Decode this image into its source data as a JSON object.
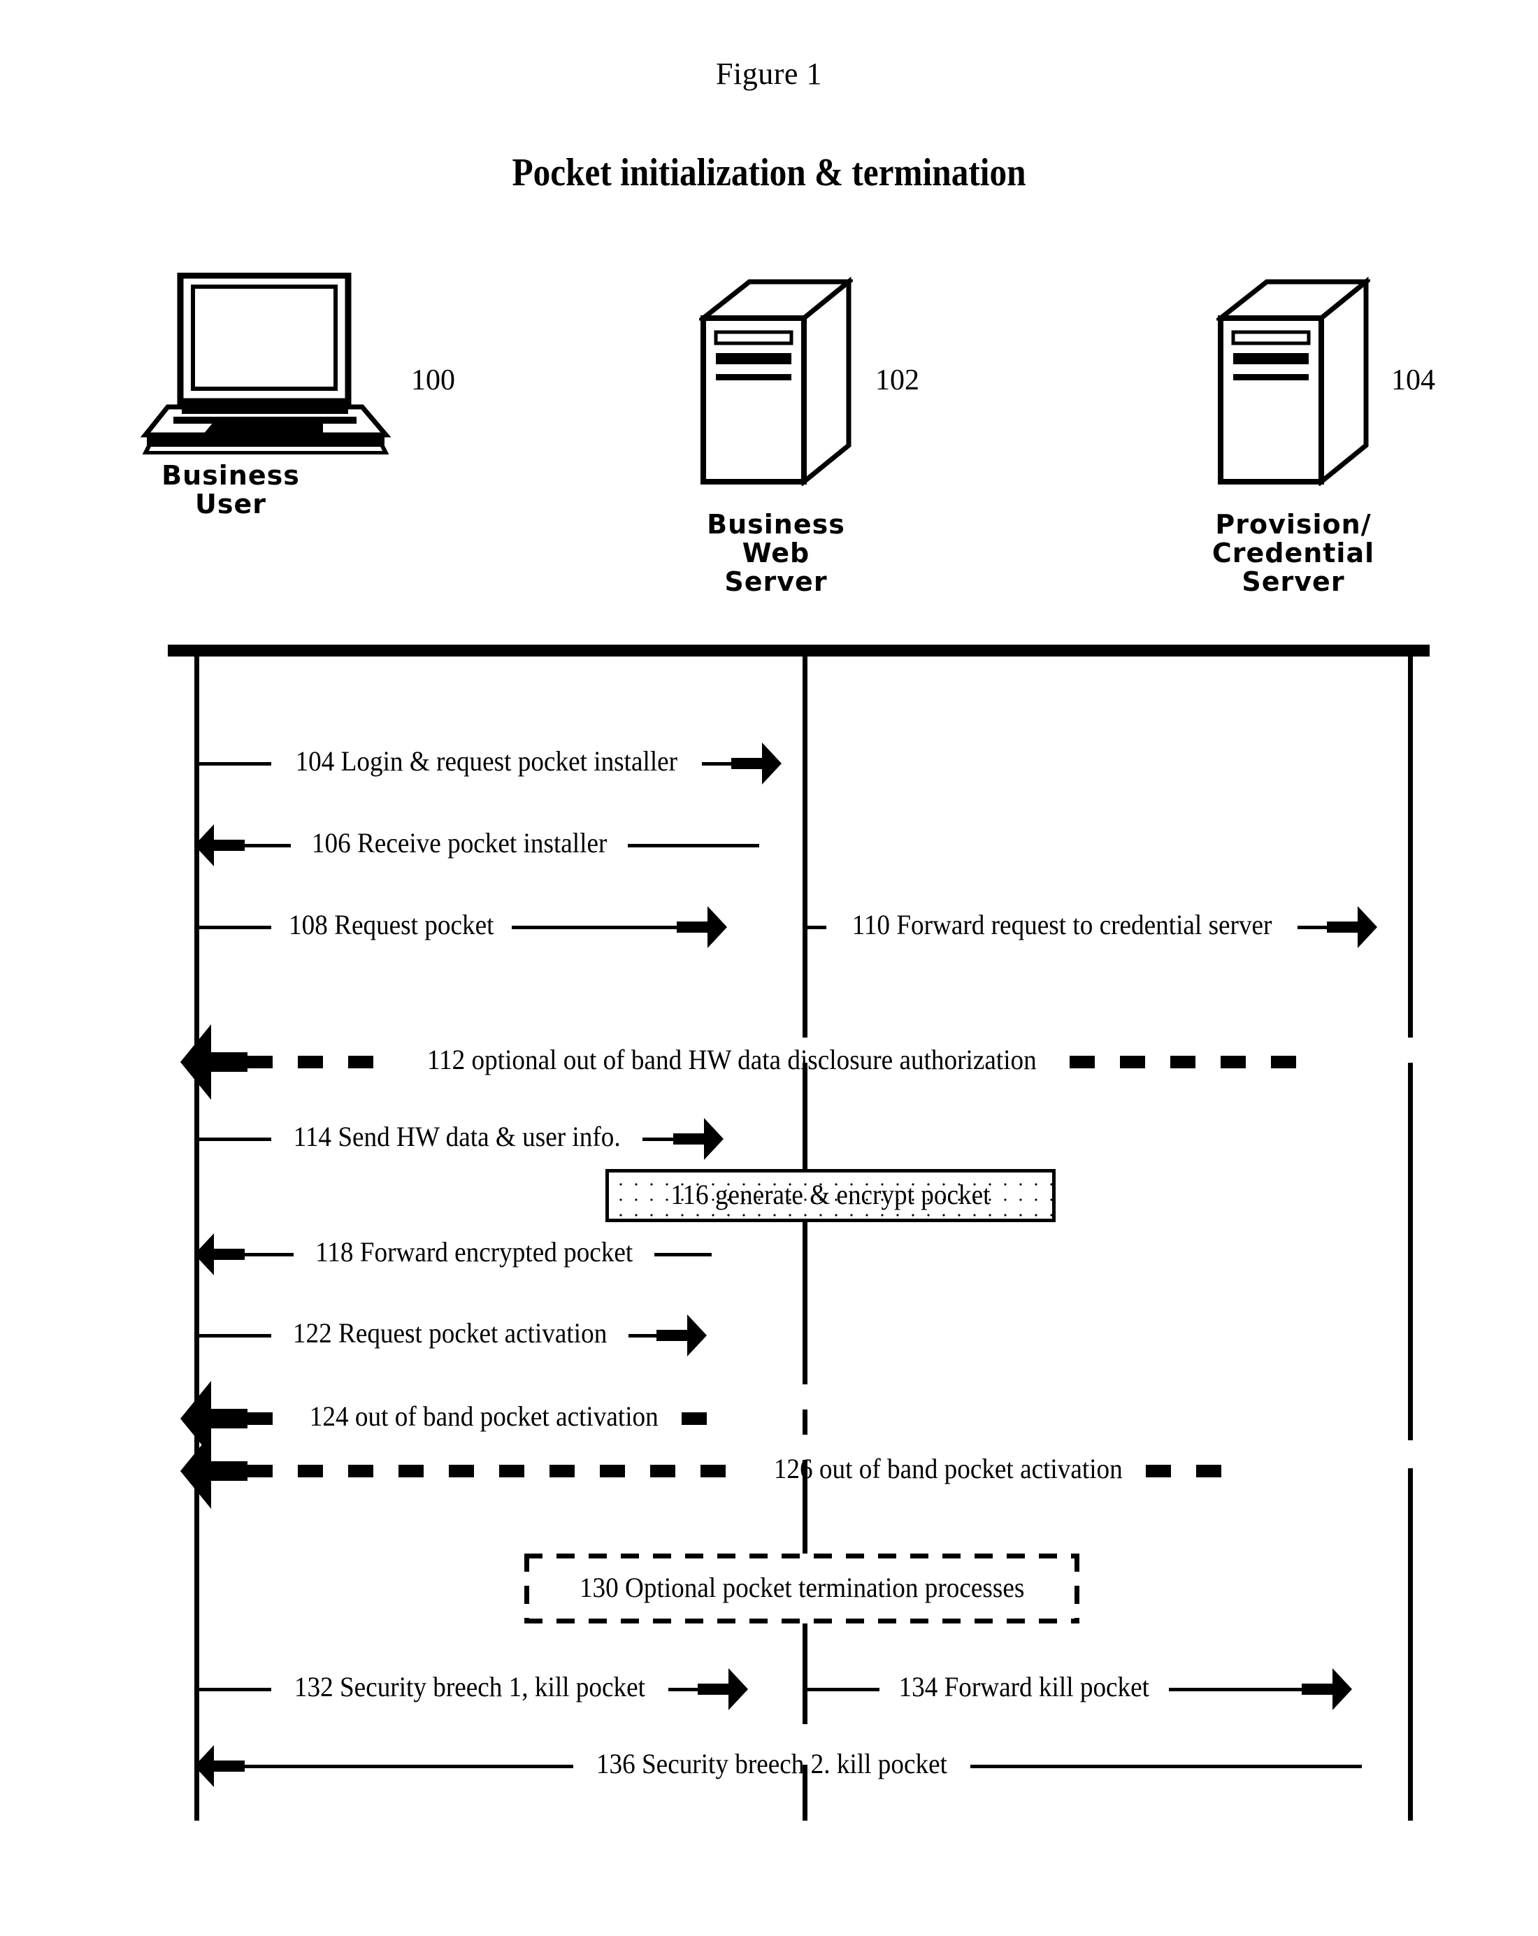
{
  "figure": {
    "label": "Figure 1",
    "title": "Pocket initialization & termination"
  },
  "actors": [
    {
      "id": "business-user",
      "label": "Business\nUser",
      "ref": "100",
      "icon": "laptop-icon"
    },
    {
      "id": "business-web-server",
      "label": "Business\nWeb\nServer",
      "ref": "102",
      "icon": "server-tower-icon"
    },
    {
      "id": "credential-server",
      "label": "Provision/\nCredential\nServer",
      "ref": "104",
      "icon": "server-tower-icon"
    }
  ],
  "messages": [
    {
      "id": "104",
      "text": "104 Login & request pocket installer",
      "from": "business-user",
      "to": "business-web-server",
      "direction": "right",
      "style": "solid"
    },
    {
      "id": "106",
      "text": "106 Receive pocket installer",
      "from": "business-web-server",
      "to": "business-user",
      "direction": "left",
      "style": "solid"
    },
    {
      "id": "108",
      "text": "108 Request pocket",
      "from": "business-user",
      "to": "business-web-server",
      "direction": "right",
      "style": "solid"
    },
    {
      "id": "110",
      "text": "110 Forward request to credential server",
      "from": "business-web-server",
      "to": "credential-server",
      "direction": "right",
      "style": "solid"
    },
    {
      "id": "112",
      "text": "112 optional out of band HW data disclosure authorization",
      "from": "credential-server",
      "to": "business-user",
      "direction": "left",
      "style": "dashed"
    },
    {
      "id": "114",
      "text": "114 Send HW data & user info.",
      "from": "business-user",
      "to": "business-web-server",
      "direction": "right",
      "style": "solid"
    },
    {
      "id": "118",
      "text": "118 Forward encrypted pocket",
      "from": "business-web-server",
      "to": "business-user",
      "direction": "left",
      "style": "solid"
    },
    {
      "id": "122",
      "text": "122 Request pocket activation",
      "from": "business-user",
      "to": "business-web-server",
      "direction": "right",
      "style": "solid"
    },
    {
      "id": "124",
      "text": "124 out of band pocket activation",
      "from": "business-web-server",
      "to": "business-user",
      "direction": "left",
      "style": "dashed"
    },
    {
      "id": "126",
      "text": "126 out of band pocket activation",
      "from": "credential-server",
      "to": "business-user",
      "direction": "left",
      "style": "dashed"
    },
    {
      "id": "132",
      "text": "132 Security breech 1, kill pocket",
      "from": "business-user",
      "to": "business-web-server",
      "direction": "right",
      "style": "solid"
    },
    {
      "id": "134",
      "text": "134 Forward kill pocket",
      "from": "business-web-server",
      "to": "credential-server",
      "direction": "right",
      "style": "solid"
    },
    {
      "id": "136",
      "text": "136 Security breech 2. kill pocket",
      "from": "credential-server",
      "to": "business-user",
      "direction": "left",
      "style": "solid"
    }
  ],
  "notes": [
    {
      "id": "116",
      "text": "116 generate & encrypt pocket",
      "border": "solid",
      "fill": "dotted"
    },
    {
      "id": "130",
      "text": "130 Optional pocket termination processes",
      "border": "dashed",
      "fill": "none"
    }
  ],
  "colors": {
    "ink": "#000000",
    "paper": "#ffffff"
  }
}
